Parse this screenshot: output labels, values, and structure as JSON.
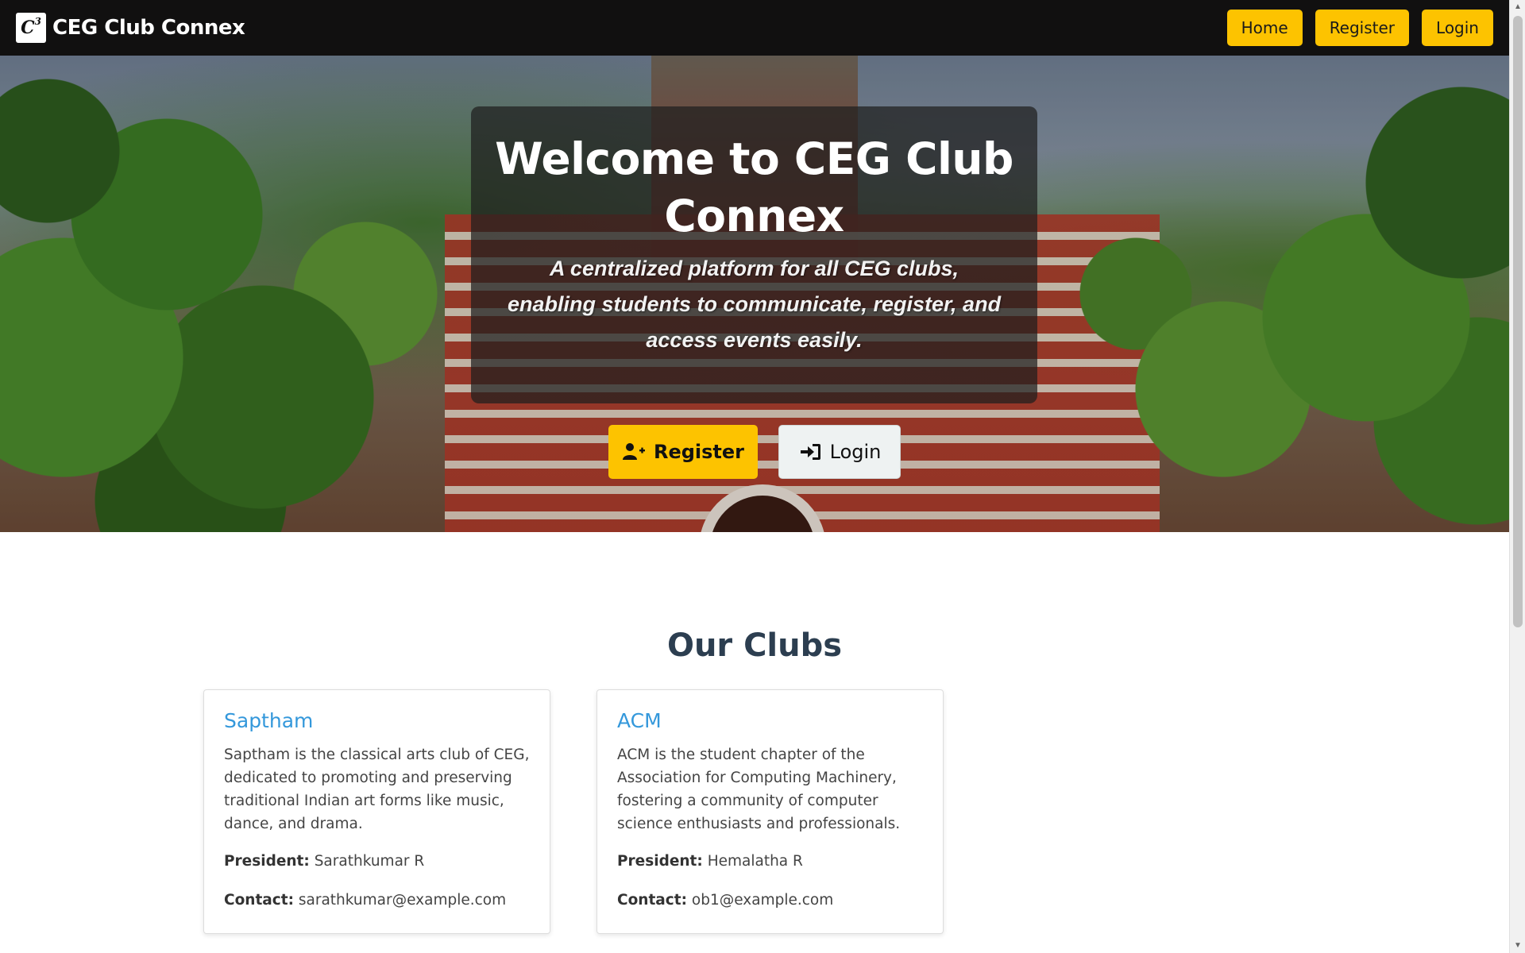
{
  "navbar": {
    "logo_text": "C",
    "logo_sup": "3",
    "brand": "CEG Club Connex",
    "links": {
      "home": "Home",
      "register": "Register",
      "login": "Login"
    }
  },
  "hero": {
    "title": "Welcome to CEG Club Connex",
    "subtitle": "A centralized platform for all CEG clubs, enabling students to communicate, register, and access events easily.",
    "register_button": "Register",
    "login_button": "Login",
    "register_icon": "user-plus-icon",
    "login_icon": "sign-in-icon"
  },
  "clubs_section": {
    "title": "Our Clubs",
    "president_label": "President:",
    "contact_label": "Contact:",
    "clubs": [
      {
        "name": "Saptham",
        "description": "Saptham is the classical arts club of CEG, dedicated to promoting and preserving traditional Indian art forms like music, dance, and drama.",
        "president": "Sarathkumar R",
        "contact": "sarathkumar@example.com"
      },
      {
        "name": "ACM",
        "description": "ACM is the student chapter of the Association for Computing Machinery, fostering a community of computer science enthusiasts and professionals.",
        "president": "Hemalatha R",
        "contact": "ob1@example.com"
      }
    ]
  },
  "colors": {
    "navbar_bg": "#111010",
    "accent": "#fdc300",
    "club_title": "#3498db",
    "section_title": "#2c3e50"
  }
}
